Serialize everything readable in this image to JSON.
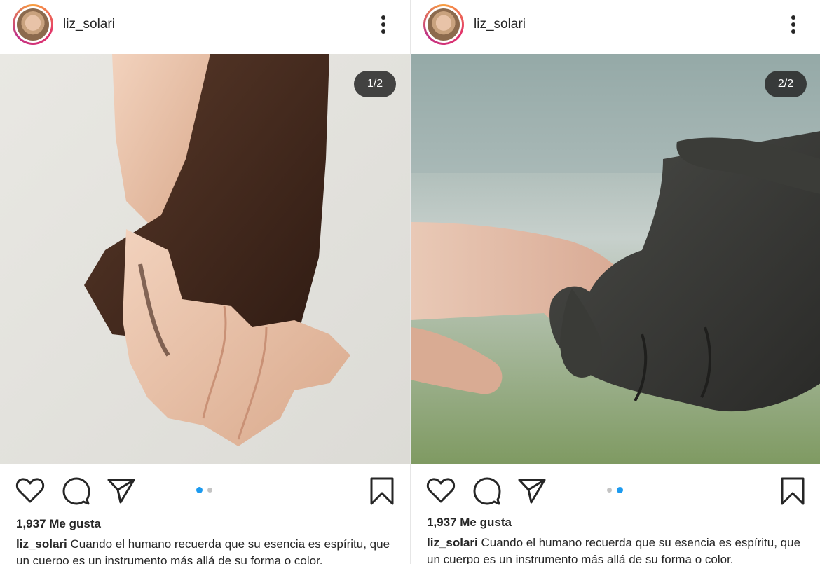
{
  "posts": [
    {
      "username": "liz_solari",
      "counter": "1/2",
      "likes": "1,937 Me gusta",
      "caption_user": "liz_solari",
      "caption_text": "Cuando el humano recuerda que su esencia es espíritu, que un cuerpo es un instrumento más allá de su forma o color.",
      "carousel": {
        "total": 2,
        "active": 1
      }
    },
    {
      "username": "liz_solari",
      "counter": "2/2",
      "likes": "1,937 Me gusta",
      "caption_user": "liz_solari",
      "caption_text": "Cuando el humano recuerda que su esencia es espíritu, que un cuerpo es un instrumento más allá de su forma o color.",
      "carousel": {
        "total": 2,
        "active": 2
      }
    }
  ],
  "icons": {
    "avatar": "avatar",
    "more": "more-vertical-icon",
    "like": "heart-icon",
    "comment": "comment-icon",
    "share": "send-icon",
    "save": "bookmark-icon"
  },
  "colors": {
    "accent": "#1d9bf0",
    "text": "#262626",
    "dot_inactive": "#c4c4c4"
  }
}
